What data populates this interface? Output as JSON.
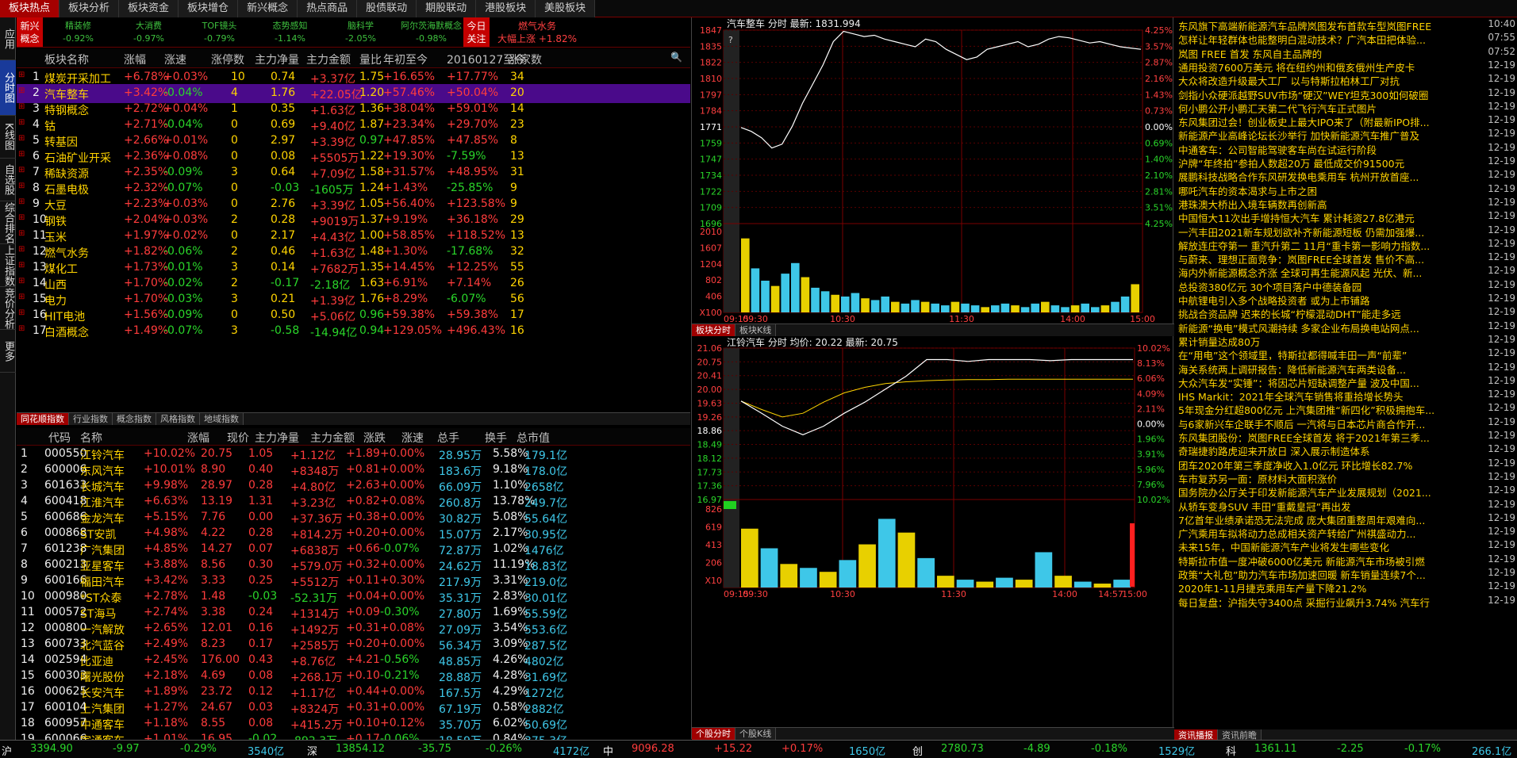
{
  "top_tabs": [
    "板块热点",
    "板块分析",
    "板块资金",
    "板块增仓",
    "新兴概念",
    "热点商品",
    "股债联动",
    "期股联动",
    "港股板块",
    "美股板块"
  ],
  "left_vtabs": [
    "应用",
    "分时图",
    "K线图",
    "自选股",
    "综合排名",
    "上证指数",
    "竞价分析",
    "更多"
  ],
  "banner": {
    "label": "新兴概念",
    "items": [
      {
        "name": "精装修",
        "value": "-0.92%"
      },
      {
        "name": "大消费",
        "value": "-0.97%"
      },
      {
        "name": "TOF镜头",
        "value": "-0.79%"
      },
      {
        "name": "态势感知",
        "value": "-1.14%"
      },
      {
        "name": "脑科学",
        "value": "-2.05%"
      },
      {
        "name": "阿尔茨海默概念",
        "value": "-0.98%"
      }
    ],
    "today_label": "今日关注",
    "hot_name": "燃气水务",
    "hot_desc": "大幅上涨 +1.82%"
  },
  "sector_header": [
    "板块名称",
    "涨幅",
    "涨速",
    "涨停数",
    "主力净量",
    "主力金额",
    "量比",
    "年初至今",
    "20160127至今",
    "涨家数"
  ],
  "sectors": [
    [
      "1",
      "煤炭开采加工",
      "+6.78%",
      "+0.03%",
      "10",
      "0.74",
      "+3.37亿",
      "1.75",
      "+16.65%",
      "+17.77%",
      "34"
    ],
    [
      "2",
      "汽车整车",
      "+3.42%",
      "-0.04%",
      "4",
      "1.76",
      "+22.05亿",
      "1.20",
      "+57.46%",
      "+50.04%",
      "20"
    ],
    [
      "3",
      "特钢概念",
      "+2.72%",
      "+0.04%",
      "1",
      "0.35",
      "+1.63亿",
      "1.36",
      "+38.04%",
      "+59.01%",
      "14"
    ],
    [
      "4",
      "钴",
      "+2.71%",
      "-0.04%",
      "0",
      "0.69",
      "+9.40亿",
      "1.87",
      "+23.34%",
      "+29.70%",
      "23"
    ],
    [
      "5",
      "转基因",
      "+2.66%",
      "+0.01%",
      "0",
      "2.97",
      "+3.39亿",
      "0.97",
      "+47.85%",
      "+47.85%",
      "8"
    ],
    [
      "6",
      "石油矿业开采",
      "+2.36%",
      "+0.08%",
      "0",
      "0.08",
      "+5505万",
      "1.22",
      "+19.30%",
      "-7.59%",
      "13"
    ],
    [
      "7",
      "稀缺资源",
      "+2.35%",
      "-0.09%",
      "3",
      "0.64",
      "+7.09亿",
      "1.58",
      "+31.57%",
      "+48.95%",
      "31"
    ],
    [
      "8",
      "石墨电极",
      "+2.32%",
      "-0.07%",
      "0",
      "-0.03",
      "-1605万",
      "1.24",
      "+1.43%",
      "-25.85%",
      "9"
    ],
    [
      "9",
      "大豆",
      "+2.23%",
      "+0.03%",
      "0",
      "2.76",
      "+3.39亿",
      "1.05",
      "+56.40%",
      "+123.58%",
      "9"
    ],
    [
      "10",
      "钢铁",
      "+2.04%",
      "+0.03%",
      "2",
      "0.28",
      "+9019万",
      "1.37",
      "+9.19%",
      "+36.18%",
      "29"
    ],
    [
      "11",
      "玉米",
      "+1.97%",
      "+0.02%",
      "0",
      "2.17",
      "+4.43亿",
      "1.00",
      "+58.85%",
      "+118.52%",
      "13"
    ],
    [
      "12",
      "燃气水务",
      "+1.82%",
      "-0.06%",
      "2",
      "0.46",
      "+1.63亿",
      "1.48",
      "+1.30%",
      "-17.68%",
      "32"
    ],
    [
      "13",
      "煤化工",
      "+1.73%",
      "-0.01%",
      "3",
      "0.14",
      "+7682万",
      "1.35",
      "+14.45%",
      "+12.25%",
      "55"
    ],
    [
      "14",
      "山西",
      "+1.70%",
      "-0.02%",
      "2",
      "-0.17",
      "-2.18亿",
      "1.63",
      "+6.91%",
      "+7.14%",
      "26"
    ],
    [
      "15",
      "电力",
      "+1.70%",
      "-0.03%",
      "3",
      "0.21",
      "+1.39亿",
      "1.76",
      "+8.29%",
      "-6.07%",
      "56"
    ],
    [
      "16",
      "HIT电池",
      "+1.56%",
      "-0.09%",
      "0",
      "0.50",
      "+5.06亿",
      "0.96",
      "+59.38%",
      "+59.38%",
      "17"
    ],
    [
      "17",
      "白酒概念",
      "+1.49%",
      "-0.07%",
      "3",
      "-0.58",
      "-14.94亿",
      "0.94",
      "+129.05%",
      "+496.43%",
      "16"
    ]
  ],
  "sub_tabs1": [
    "同花顺指数",
    "行业指数",
    "概念指数",
    "风格指数",
    "地域指数"
  ],
  "stock_header": [
    "代码",
    "名称",
    "涨幅",
    "现价",
    "主力净量",
    "主力金额",
    "涨跌",
    "涨速",
    "总手",
    "换手",
    "总市值"
  ],
  "stocks": [
    [
      "1",
      "000550",
      "江铃汽车",
      "+10.02%",
      "20.75",
      "1.05",
      "+1.12亿",
      "+1.89",
      "+0.00%",
      "28.95万",
      "5.58%",
      "179.1亿"
    ],
    [
      "2",
      "600006",
      "东风汽车",
      "+10.01%",
      "8.90",
      "0.40",
      "+8348万",
      "+0.81",
      "+0.00%",
      "183.6万",
      "9.18%",
      "178.0亿"
    ],
    [
      "3",
      "601633",
      "长城汽车",
      "+9.98%",
      "28.97",
      "0.28",
      "+4.80亿",
      "+2.63",
      "+0.00%",
      "66.09万",
      "1.10%",
      "2658亿"
    ],
    [
      "4",
      "600418",
      "江淮汽车",
      "+6.63%",
      "13.19",
      "1.31",
      "+3.23亿",
      "+0.82",
      "+0.08%",
      "260.8万",
      "13.78%",
      "249.7亿"
    ],
    [
      "5",
      "600686",
      "金龙汽车",
      "+5.15%",
      "7.76",
      "0.00",
      "+37.36万",
      "+0.38",
      "+0.00%",
      "30.82万",
      "5.08%",
      "55.64亿"
    ],
    [
      "6",
      "000868",
      "ST安凯",
      "+4.98%",
      "4.22",
      "0.28",
      "+814.2万",
      "+0.20",
      "+0.00%",
      "15.07万",
      "2.17%",
      "30.95亿"
    ],
    [
      "7",
      "601238",
      "广汽集团",
      "+4.85%",
      "14.27",
      "0.07",
      "+6838万",
      "+0.66",
      "-0.07%",
      "72.87万",
      "1.02%",
      "1476亿"
    ],
    [
      "8",
      "600213",
      "亚星客车",
      "+3.88%",
      "8.56",
      "0.30",
      "+579.0万",
      "+0.32",
      "+0.00%",
      "24.62万",
      "11.19%",
      "18.83亿"
    ],
    [
      "9",
      "600166",
      "福田汽车",
      "+3.42%",
      "3.33",
      "0.25",
      "+5512万",
      "+0.11",
      "+0.30%",
      "217.9万",
      "3.31%",
      "219.0亿"
    ],
    [
      "10",
      "000980",
      "*ST众泰",
      "+2.78%",
      "1.48",
      "-0.03",
      "-52.31万",
      "+0.04",
      "+0.00%",
      "35.31万",
      "2.83%",
      "30.01亿"
    ],
    [
      "11",
      "000572",
      "ST海马",
      "+2.74%",
      "3.38",
      "0.24",
      "+1314万",
      "+0.09",
      "-0.30%",
      "27.80万",
      "1.69%",
      "55.59亿"
    ],
    [
      "12",
      "000800",
      "一汽解放",
      "+2.65%",
      "12.01",
      "0.16",
      "+1492万",
      "+0.31",
      "+0.08%",
      "27.09万",
      "3.54%",
      "553.6亿"
    ],
    [
      "13",
      "600733",
      "北汽蓝谷",
      "+2.49%",
      "8.23",
      "0.17",
      "+2585万",
      "+0.20",
      "+0.00%",
      "56.34万",
      "3.09%",
      "287.5亿"
    ],
    [
      "14",
      "002594",
      "比亚迪",
      "+2.45%",
      "176.00",
      "0.43",
      "+8.76亿",
      "+4.21",
      "-0.56%",
      "48.85万",
      "4.26%",
      "4802亿"
    ],
    [
      "15",
      "600303",
      "曙光股份",
      "+2.18%",
      "4.69",
      "0.08",
      "+268.1万",
      "+0.10",
      "-0.21%",
      "28.88万",
      "4.28%",
      "31.69亿"
    ],
    [
      "16",
      "000625",
      "长安汽车",
      "+1.89%",
      "23.72",
      "0.12",
      "+1.17亿",
      "+0.44",
      "+0.00%",
      "167.5万",
      "4.29%",
      "1272亿"
    ],
    [
      "17",
      "600104",
      "上汽集团",
      "+1.27%",
      "24.67",
      "0.03",
      "+8324万",
      "+0.31",
      "+0.00%",
      "67.19万",
      "0.58%",
      "2882亿"
    ],
    [
      "18",
      "600957",
      "中通客车",
      "+1.18%",
      "8.55",
      "0.08",
      "+415.2万",
      "+0.10",
      "+0.12%",
      "35.70万",
      "6.02%",
      "50.69亿"
    ],
    [
      "19",
      "600066",
      "宇通客车",
      "+1.01%",
      "16.95",
      "-0.02",
      "-892.3万",
      "+0.17",
      "-0.06%",
      "18.59万",
      "0.84%",
      "375.3亿"
    ]
  ],
  "chart1": {
    "title": "汽车整车 分时 最新: 1831.994",
    "y_left": [
      "1847",
      "1835",
      "1822",
      "1810",
      "1797",
      "1784",
      "1771",
      "1759",
      "1747",
      "1734",
      "1722",
      "1709",
      "1696"
    ],
    "y_right": [
      "4.25%",
      "3.57%",
      "2.87%",
      "2.16%",
      "1.43%",
      "0.73%",
      "0.00%",
      "0.69%",
      "1.40%",
      "2.10%",
      "2.81%",
      "3.51%",
      "4.25%"
    ],
    "vol_labels": [
      "2010",
      "1607",
      "1204",
      "802",
      "406",
      "X100"
    ],
    "times": [
      "09:15",
      "09:30",
      "10:30",
      "11:30",
      "14:00",
      "15:00"
    ],
    "price": [
      1771,
      1768,
      1763,
      1755,
      1758,
      1772,
      1790,
      1805,
      1820,
      1838,
      1846,
      1844,
      1842,
      1843,
      1840,
      1838,
      1836,
      1834,
      1840,
      1838,
      1832,
      1828,
      1824,
      1826,
      1832,
      1834,
      1836,
      1838,
      1834,
      1836,
      1840,
      1842,
      1841,
      1839,
      1837,
      1838,
      1836,
      1834,
      1833,
      1832
    ],
    "vol": [
      42,
      25,
      18,
      15,
      22,
      28,
      20,
      14,
      12,
      10,
      9,
      11,
      8,
      7,
      9,
      6,
      5,
      7,
      6,
      5,
      4,
      6,
      5,
      4,
      3,
      4,
      5,
      4,
      3,
      5,
      6,
      4,
      3,
      4,
      5,
      3,
      4,
      6,
      9,
      16
    ]
  },
  "btabs1": [
    "板块分时",
    "板块K线"
  ],
  "chart2": {
    "title": "江铃汽车 分时 均价: 20.22 最新: 20.75",
    "y_left": [
      "21.06",
      "20.75",
      "20.41",
      "20.00",
      "19.63",
      "19.26",
      "18.86",
      "18.49",
      "18.12",
      "17.73",
      "17.36",
      "16.97"
    ],
    "y_right": [
      "10.02%",
      "8.13%",
      "6.06%",
      "4.09%",
      "2.11%",
      "0.00%",
      "1.96%",
      "3.91%",
      "5.96%",
      "7.96%",
      "10.02%"
    ],
    "vol_labels": [
      "826",
      "619",
      "413",
      "206",
      "X10"
    ],
    "times": [
      "09:15",
      "09:30",
      "10:30",
      "11:30",
      "14:00",
      "14:57",
      "15:00"
    ],
    "price": [
      19.63,
      19.3,
      18.95,
      18.72,
      18.95,
      19.3,
      19.6,
      19.95,
      20.3,
      20.75,
      20.75,
      20.7,
      20.75,
      20.75,
      20.75,
      20.72,
      20.75,
      20.75,
      20.75,
      20.75
    ],
    "avg": [
      19.63,
      19.4,
      19.2,
      19.3,
      19.6,
      19.85,
      20.0,
      20.1,
      20.15,
      20.18,
      20.2,
      20.21,
      20.21,
      20.22,
      20.22,
      20.22,
      20.22,
      20.22,
      20.22,
      20.22
    ],
    "vol": [
      30,
      20,
      12,
      10,
      8,
      14,
      22,
      35,
      28,
      15,
      6,
      4,
      3,
      5,
      4,
      18,
      6,
      3,
      2,
      4
    ]
  },
  "btabs2": [
    "个股分时",
    "个股K线"
  ],
  "news": [
    [
      "东风旗下高端新能源汽车品牌岚图发布首款车型岚图FREE",
      "10:40"
    ],
    [
      "怎样让年轻群体也能整明白混动技术？广汽本田把体验...",
      "07:55"
    ],
    [
      "岚图 FREE 首发 东风自主品牌的",
      "07:52"
    ],
    [
      "通用投资7600万美元 将在纽约州和俄亥俄州生产皮卡",
      "12-19"
    ],
    [
      "大众将改造升级最大工厂 以与特斯拉柏林工厂对抗",
      "12-19"
    ],
    [
      "剑指小众硬派越野SUV市场“硬汉”WEY坦克300如何破圈",
      "12-19"
    ],
    [
      "何小鹏公开小鹏汇天第二代飞行汽车正式图片",
      "12-19"
    ],
    [
      "东风集团过会！创业板史上最大IPO来了（附最新IPO排...",
      "12-19"
    ],
    [
      "新能源产业高峰论坛长沙举行 加快新能源汽车推广普及",
      "12-19"
    ],
    [
      "中通客车：公司智能驾驶客车尚在试运行阶段",
      "12-19"
    ],
    [
      "沪牌“年终拍”参拍人数超20万 最低成交价91500元",
      "12-19"
    ],
    [
      "展鹏科技战略合作东风研发换电乘用车 杭州开放首座...",
      "12-19"
    ],
    [
      "哪吒汽车的资本渴求与上市之困",
      "12-19"
    ],
    [
      "港珠澳大桥出入境车辆数再创新高",
      "12-19"
    ],
    [
      "中国恒大11次出手增持恒大汽车 累计耗资27.8亿港元",
      "12-19"
    ],
    [
      "一汽丰田2021新车规划欲补齐新能源短板 仍需加强爆...",
      "12-19"
    ],
    [
      "解放连庄夺第一 重汽升第二 11月“重卡第一影响力指数...",
      "12-19"
    ],
    [
      "与蔚来、理想正面竞争：岚图FREE全球首发 售价不高...",
      "12-19"
    ],
    [
      "海内外新能源概念齐涨 全球可再生能源风起 光伏、新...",
      "12-19"
    ],
    [
      "总投资380亿元 30个项目落户中德装备园",
      "12-19"
    ],
    [
      "中航锂电引入多个战略投资者 或为上市铺路",
      "12-19"
    ],
    [
      "挑战合资品牌 迟来的长城“柠檬混动DHT”能走多远",
      "12-19"
    ],
    [
      "新能源“换电”模式风潮持续 多家企业布局换电站网点...",
      "12-19"
    ],
    [
      "累计销量达成80万",
      "12-19"
    ],
    [
      "在“用电”这个领域里，特斯拉都得喊丰田一声“前辈”",
      "12-19"
    ],
    [
      "海关系统两上调研报告：降低新能源汽车两类设备...",
      "12-19"
    ],
    [
      "大众汽车发“实锤”：将因芯片短缺调整产量 波及中国...",
      "12-19"
    ],
    [
      "IHS Markit：2021年全球汽车销售将重拾增长势头",
      "12-19"
    ],
    [
      "5年现金分红超800亿元 上汽集团推“新四化”积极拥抱车...",
      "12-19"
    ],
    [
      "与6家新兴车企联手不顺后 一汽将与日本芯片商合作开...",
      "12-19"
    ],
    [
      "东风集团股份：岚图FREE全球首发 将于2021年第三季...",
      "12-19"
    ],
    [
      "奇瑞捷豹路虎迎来开放日 深入展示制造体系",
      "12-19"
    ],
    [
      "团车2020年第三季度净收入1.0亿元 环比增长82.7%",
      "12-19"
    ],
    [
      "车市复苏另一面：原材料大面积涨价",
      "12-19"
    ],
    [
      "国务院办公厅关于印发新能源汽车产业发展规划（2021...",
      "12-19"
    ],
    [
      "从轿车变身SUV 丰田“重戴皇冠”再出发",
      "12-19"
    ],
    [
      "7亿首年业绩承诺恐无法完成 庞大集团重整周年艰难向...",
      "12-19"
    ],
    [
      "广汽乘用车拟将动力总成相关资产转给广州祺盛动力...",
      "12-19"
    ],
    [
      "未来15年，中国新能源汽车产业将发生哪些变化",
      "12-19"
    ],
    [
      "特斯拉市值一度冲破6000亿美元 新能源汽车市场被引燃",
      "12-19"
    ],
    [
      "政策“大礼包”助力汽车市场加速回暖 新车销量连续7个...",
      "12-19"
    ],
    [
      "2020年1-11月捷克乘用车产量下降21.2%",
      "12-19"
    ],
    [
      "每日复盘：沪指失守3400点 采掘行业飙升3.74% 汽车行",
      "12-19"
    ]
  ],
  "news_tabs": [
    "资讯播报",
    "资讯前瞻"
  ],
  "status": [
    {
      "ex": "沪",
      "idx": "3394.90",
      "chg": "-9.97",
      "pct": "-0.29%",
      "amt": "3540亿"
    },
    {
      "ex": "深",
      "idx": "13854.12",
      "chg": "-35.75",
      "pct": "-0.26%",
      "amt": "4172亿"
    },
    {
      "ex": "中",
      "idx": "9096.28",
      "chg": "+15.22",
      "pct": "+0.17%",
      "amt": "1650亿"
    },
    {
      "ex": "创",
      "idx": "2780.73",
      "chg": "-4.89",
      "pct": "-0.18%",
      "amt": "1529亿"
    },
    {
      "ex": "科",
      "idx": "1361.11",
      "chg": "-2.25",
      "pct": "-0.17%",
      "amt": "266.1亿"
    }
  ]
}
